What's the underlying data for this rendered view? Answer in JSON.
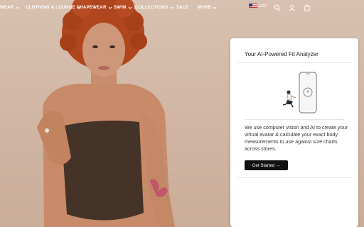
{
  "nav": {
    "items": [
      {
        "label": "WEAR",
        "has_dropdown": true
      },
      {
        "label": "CLOTHING & LOUNGE",
        "has_dropdown": true
      },
      {
        "label": "SHAPEWEAR",
        "has_dropdown": true
      },
      {
        "label": "SWIM",
        "has_dropdown": true
      },
      {
        "label": "COLLECTIONS",
        "has_dropdown": true
      },
      {
        "label": "SALE",
        "has_dropdown": false
      },
      {
        "label": "MORE",
        "has_dropdown": true
      }
    ],
    "currency": "USD",
    "flag_icon": "us-flag-icon",
    "icons": [
      "search-icon",
      "user-icon",
      "shopping-bag-icon"
    ]
  },
  "fit_panel": {
    "title": "Your AI-Powered Fit Analyzer",
    "description": "We use computer vision and AI to create your virtual avatar & calculate your exact body measurements to use against size charts across stores.",
    "cta_label": "Get Started →"
  },
  "colors": {
    "background": "#d6bfae",
    "nav_text": "#ffffff",
    "cta_bg": "#111111",
    "cta_text": "#ffffff"
  }
}
